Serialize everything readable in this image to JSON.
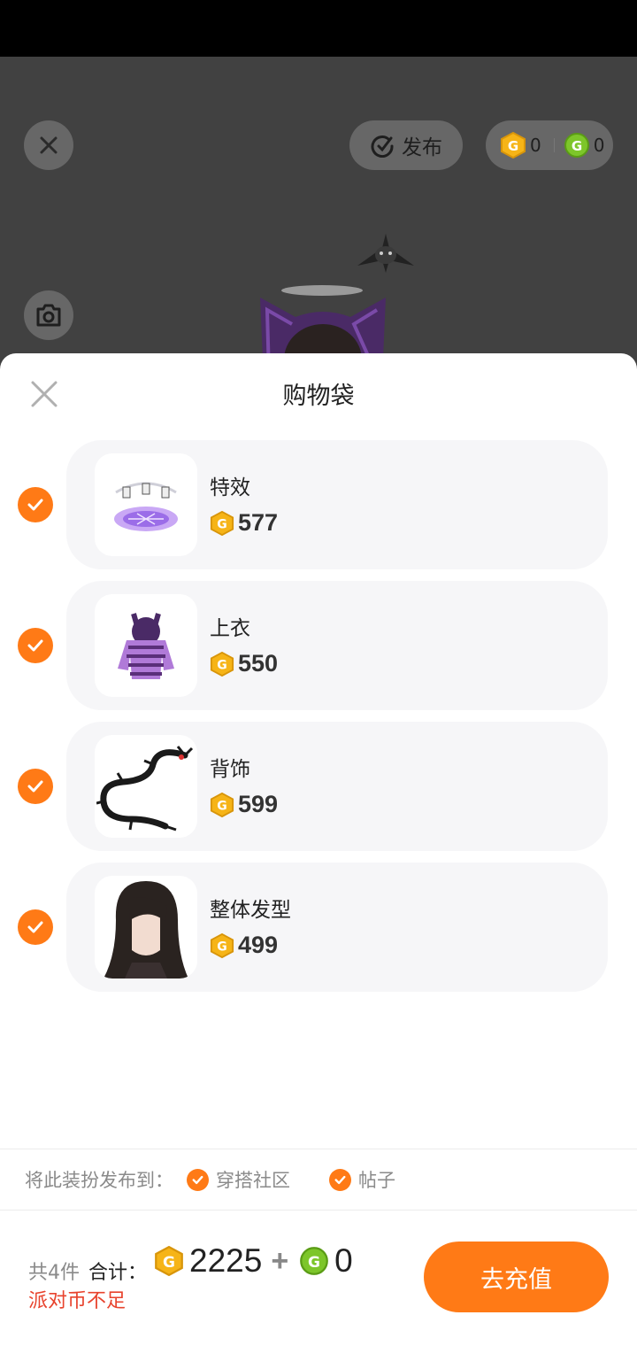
{
  "top": {
    "publish_label": "发布",
    "balance": {
      "gold": "0",
      "green": "0"
    }
  },
  "sheet": {
    "title": "购物袋",
    "items": [
      {
        "name": "特效",
        "price": "577",
        "thumb_icon": "effect-icon"
      },
      {
        "name": "上衣",
        "price": "550",
        "thumb_icon": "hoodie-icon"
      },
      {
        "name": "背饰",
        "price": "599",
        "thumb_icon": "dragon-icon"
      },
      {
        "name": "整体发型",
        "price": "499",
        "thumb_icon": "hair-icon"
      }
    ],
    "publish": {
      "label": "将此装扮发布到：",
      "options": [
        "穿搭社区",
        "帖子"
      ]
    },
    "footer": {
      "count": "共4件",
      "total_label": "合计：",
      "gold_total": "2225",
      "plus": "+",
      "green_total": "0",
      "warning": "派对币不足",
      "recharge_label": "去充值"
    }
  },
  "colors": {
    "accent": "#ff7a16",
    "warning": "#e8432d",
    "coin_gold": "#f6b417",
    "coin_green": "#7dc62a"
  }
}
